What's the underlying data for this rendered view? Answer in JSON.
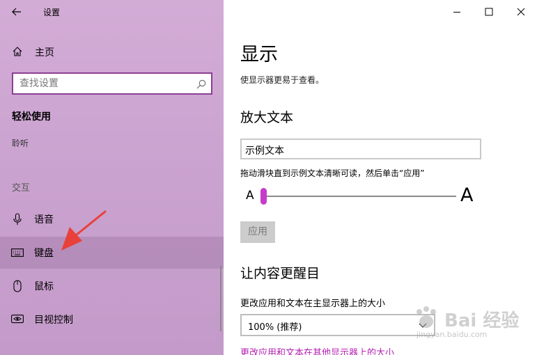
{
  "window": {
    "title": "设置"
  },
  "sidebar": {
    "home_label": "主页",
    "search_placeholder": "查找设置",
    "section_title": "轻松使用",
    "group_hearing": "聆听",
    "group_interaction": "交互",
    "items": [
      {
        "label": "语音",
        "icon": "microphone-icon"
      },
      {
        "label": "键盘",
        "icon": "keyboard-icon",
        "selected": true
      },
      {
        "label": "鼠标",
        "icon": "mouse-icon"
      },
      {
        "label": "目视控制",
        "icon": "eye-control-icon"
      }
    ]
  },
  "main": {
    "title": "显示",
    "description": "使显示器更易于查看。",
    "zoom_text": {
      "heading": "放大文本",
      "sample_text": "示例文本",
      "hint": "拖动滑块直到示例文本清晰可读，然后单击“应用”",
      "slider_min_label": "A",
      "slider_max_label": "A",
      "slider_value_fraction": 0.0,
      "apply_label": "应用"
    },
    "bigger": {
      "heading": "让内容更醒目",
      "scale_label": "更改应用和文本在主显示器上的大小",
      "scale_value": "100% (推荐)",
      "other_displays_link": "更改应用和文本在其他显示器上的大小"
    }
  },
  "watermark": {
    "text": "Bai 经验",
    "sub": "jingyan.baidu.com"
  },
  "colors": {
    "accent": "#c63cc9",
    "search_border": "#8d3e96",
    "link": "#b51fb3",
    "arrow": "#e8413a"
  }
}
